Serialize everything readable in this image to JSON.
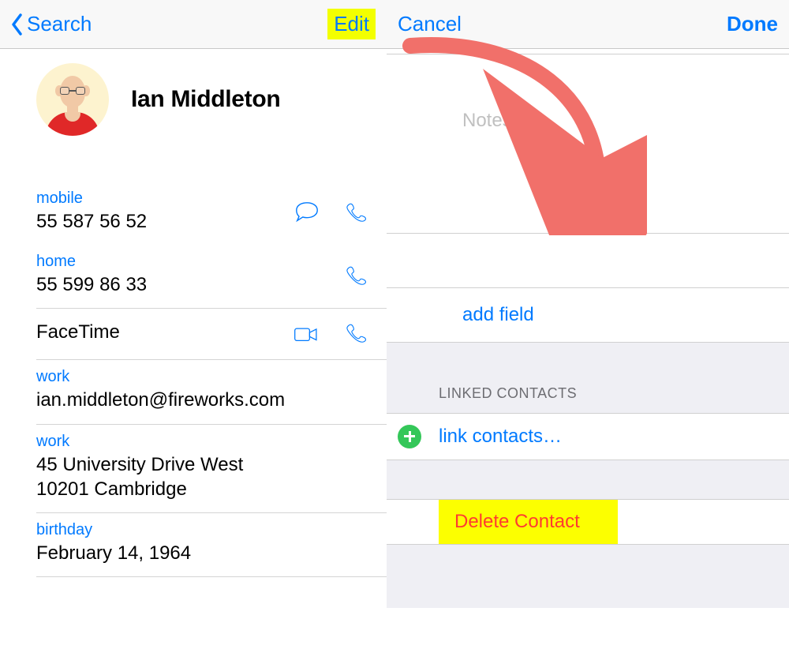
{
  "left": {
    "nav": {
      "back_label": "Search",
      "edit_label": "Edit"
    },
    "contact": {
      "name": "Ian Middleton"
    },
    "fields": {
      "mobile": {
        "label": "mobile",
        "value": "55 587 56 52"
      },
      "home": {
        "label": "home",
        "value": "55 599 86 33"
      },
      "facetime": {
        "label": "FaceTime"
      },
      "email": {
        "label": "work",
        "value": "ian.middleton@fireworks.com"
      },
      "address": {
        "label": "work",
        "line1": "45 University Drive West",
        "line2": "10201 Cambridge"
      },
      "birthday": {
        "label": "birthday",
        "value": "February 14, 1964"
      }
    }
  },
  "right": {
    "nav": {
      "cancel_label": "Cancel",
      "done_label": "Done"
    },
    "notes_label": "Notes",
    "add_field_label": "add field",
    "linked_header": "LINKED CONTACTS",
    "link_contacts_label": "link contacts…",
    "delete_label": "Delete Contact"
  },
  "colors": {
    "ios_blue": "#007aff",
    "highlight_yellow": "#f3ff00",
    "delete_red": "#ff3b30",
    "arrow_red": "#f1706a"
  }
}
